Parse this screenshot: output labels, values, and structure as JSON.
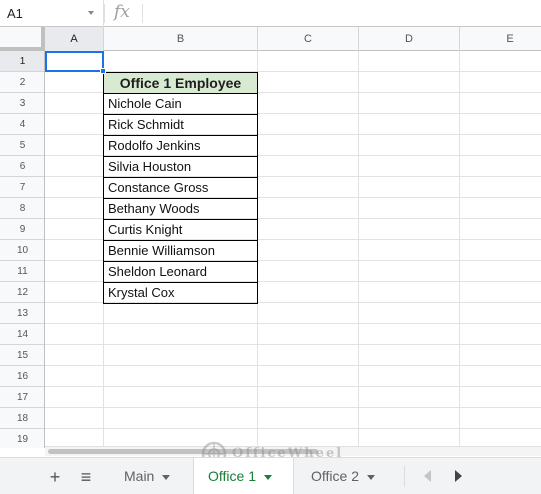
{
  "formula_bar": {
    "name_box": "A1",
    "fx_label": "fx",
    "formula": ""
  },
  "columns": [
    {
      "label": "A",
      "selected": true
    },
    {
      "label": "B",
      "selected": false
    },
    {
      "label": "C",
      "selected": false
    },
    {
      "label": "D",
      "selected": false
    },
    {
      "label": "E",
      "selected": false
    }
  ],
  "rows": [
    "1",
    "2",
    "3",
    "4",
    "5",
    "6",
    "7",
    "8",
    "9",
    "10",
    "11",
    "12",
    "13",
    "14",
    "15",
    "16",
    "17",
    "18",
    "19"
  ],
  "selected_row": "1",
  "table": {
    "header": "Office 1 Employee",
    "employees": [
      "Nichole Cain",
      "Rick Schmidt",
      "Rodolfo Jenkins",
      "Silvia Houston",
      "Constance Gross",
      "Bethany Woods",
      "Curtis Knight",
      "Bennie Williamson",
      "Sheldon Leonard",
      "Krystal Cox"
    ],
    "header_fill": "#d9ead3"
  },
  "watermark": "OfficeWheel",
  "sheet_tabs": [
    {
      "label": "Main",
      "active": false
    },
    {
      "label": "Office 1",
      "active": true
    },
    {
      "label": "Office 2",
      "active": false
    }
  ],
  "toolbar_buttons": {
    "add": "+",
    "all_sheets": "≡"
  },
  "colors": {
    "active_tab": "#188038",
    "selection": "#1a73e8"
  }
}
